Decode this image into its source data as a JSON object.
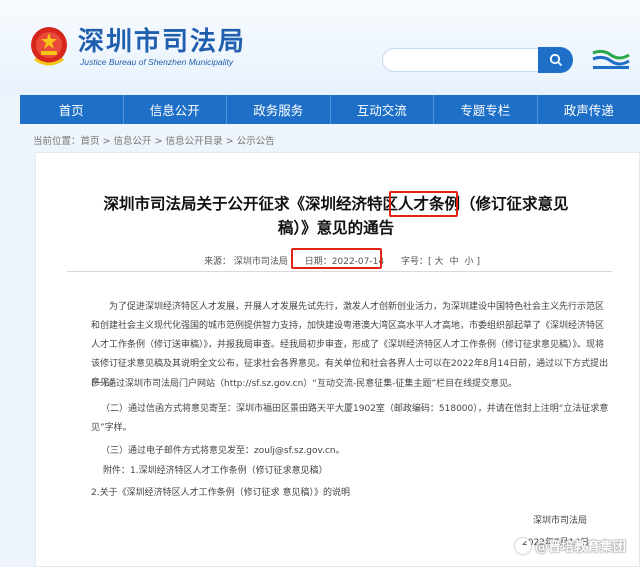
{
  "header": {
    "title": "深圳市司法局",
    "subtitle": "Justice Bureau of Shenzhen Municipality",
    "search_placeholder": ""
  },
  "nav": {
    "items": [
      {
        "label": "首页"
      },
      {
        "label": "信息公开"
      },
      {
        "label": "政务服务"
      },
      {
        "label": "互动交流"
      },
      {
        "label": "专题专栏"
      },
      {
        "label": "政声传递"
      }
    ]
  },
  "breadcrumb": {
    "prefix": "当前位置：",
    "items": [
      "首页",
      "信息公开",
      "信息公开目录",
      "公示公告"
    ],
    "separator": " > "
  },
  "article": {
    "title": "深圳市司法局关于公开征求《深圳经济特区人才条例（修订征求意见稿）》意见的通告",
    "meta_source_label": "来源：",
    "meta_source": "深圳市司法局",
    "meta_date": "日期：2022-07-14",
    "meta_size_label": "字号：[",
    "meta_size_large": "大",
    "meta_size_medium": "中",
    "meta_size_small": "小",
    "meta_size_close": "]",
    "para1": "为了促进深圳经济特区人才发展，开展人才发展先试先行，激发人才创新创业活力，为深圳建设中国特色社会主义先行示范区和创建社会主义现代化强国的城市范例提供智力支持，加快建设粤港澳大湾区高水平人才高地，市委组织部起草了《深圳经济特区人才工作条例（修订送审稿）》，并报我局审查。经我局初步审查，形成了《深圳经济特区人才工作条例（修订征求意见稿）》。现将该修订征求意见稿及其说明全文公布，征求社会各界意见。有关单位和社会各界人士可以在2022年8月14日前，通过以下方式提出意见：",
    "para2": "(一)通过深圳市司法局门户网站（http://sf.sz.gov.cn）“互动交流-民意征集-征集主题”栏目在线提交意见。",
    "para3": "（二）通过信函方式将意见寄至：深圳市福田区景田路天平大厦1902室（邮政编码：518000），并请在信封上注明“立法征求意见”字样。",
    "para4": "（三）通过电子邮件方式将意见发至：zoulj@sf.sz.gov.cn。",
    "attach1": "附件：1.深圳经济特区人才工作条例（修订征求意见稿）",
    "attach2": "2.关于《深圳经济特区人才工作条例（修订征求 意见稿）》的说明",
    "signature": "深圳市司法局",
    "sign_date": "2022年7月14日"
  },
  "watermark": "@晋培教育集团",
  "colors": {
    "nav_bg": "#1e6fc8",
    "title_blue": "#1f5fae",
    "highlight_red": "#e2231a"
  }
}
